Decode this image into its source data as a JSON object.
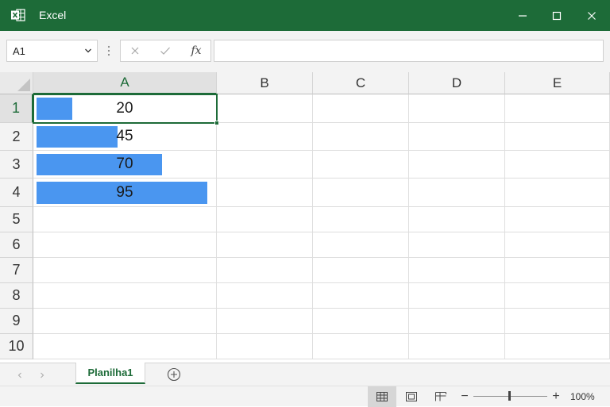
{
  "window": {
    "title": "Excel",
    "accent_color": "#1d6b38",
    "icons": [
      "excel-icon",
      "minimize-icon",
      "maximize-icon",
      "close-icon"
    ]
  },
  "formula_bar": {
    "name_box": "A1",
    "cancel_icon": "close-icon",
    "enter_icon": "check-icon",
    "fx_label": "fx",
    "formula_value": ""
  },
  "columns": [
    "A",
    "B",
    "C",
    "D",
    "E"
  ],
  "rows": [
    "1",
    "2",
    "3",
    "4",
    "5",
    "6",
    "7",
    "8",
    "9",
    "10"
  ],
  "cells": {
    "A1": "20",
    "A2": "45",
    "A3": "70",
    "A4": "95"
  },
  "data_bars": {
    "color": "#4a96f0",
    "max_value": 95,
    "values": [
      20,
      45,
      70,
      95
    ]
  },
  "selected_cell": "A1",
  "sheets": {
    "active": "Planilha1",
    "tabs": [
      "Planilha1"
    ]
  },
  "status_bar": {
    "zoom_level": "100%",
    "views": [
      "normal-view-icon",
      "page-layout-icon",
      "page-break-preview-icon"
    ],
    "active_view": "normal-view-icon"
  }
}
